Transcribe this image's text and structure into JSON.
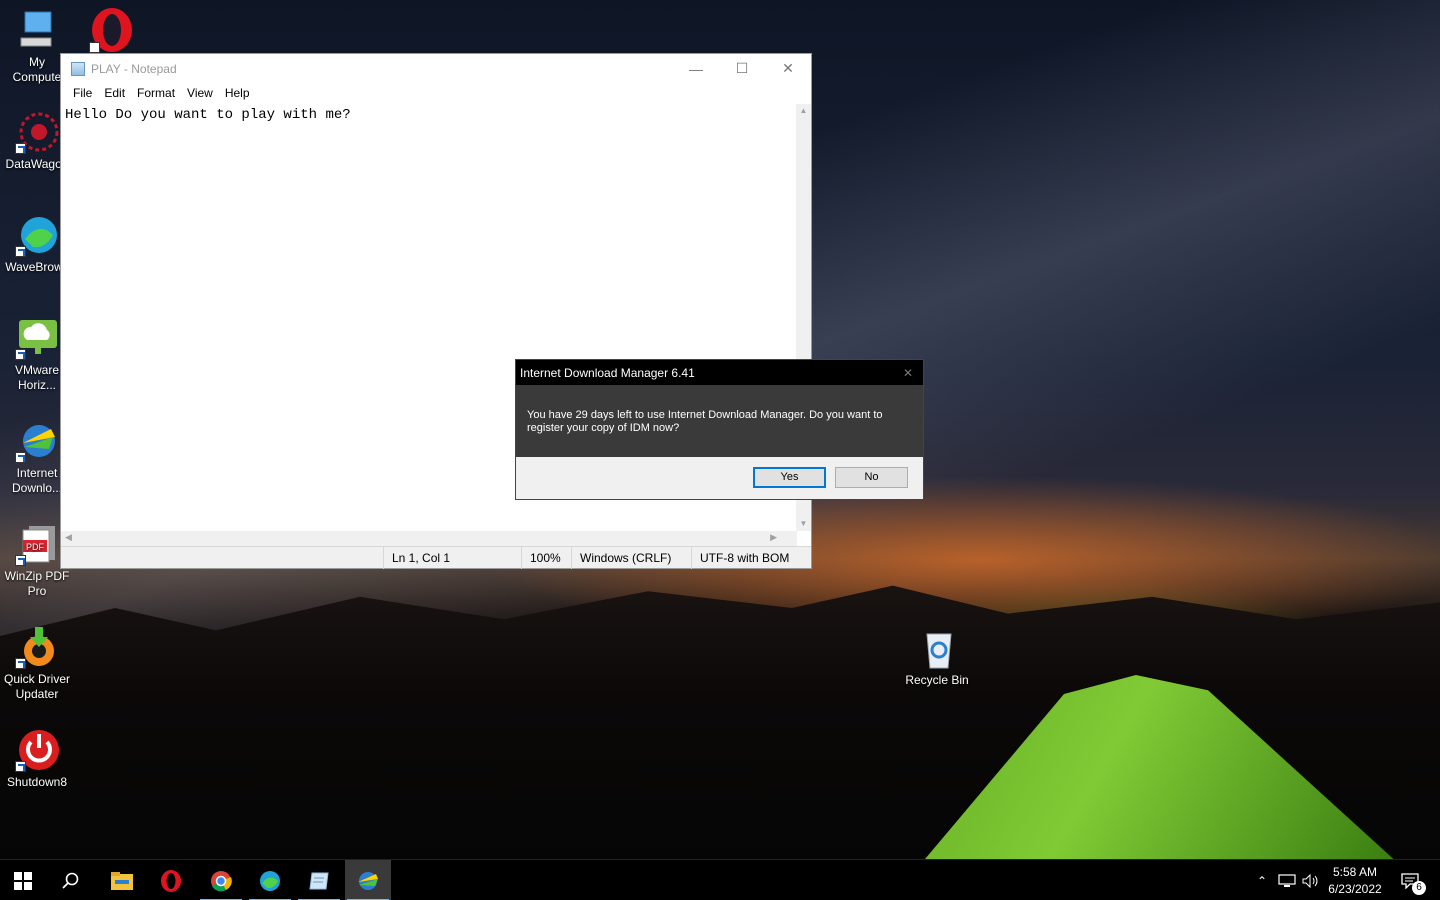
{
  "desktop": {
    "icons": [
      {
        "label": "My\nCompute",
        "icon": "computer-icon"
      },
      {
        "label": "DataWagon",
        "icon": "datawagon-icon"
      },
      {
        "label": "WaveBrows",
        "icon": "wavebrowser-icon"
      },
      {
        "label": "VMware\nHoriz...",
        "icon": "vmware-horizon-icon"
      },
      {
        "label": "Internet\nDownlo...",
        "icon": "idm-icon"
      },
      {
        "label": "WinZip PDF\nPro",
        "icon": "winzip-pdf-icon"
      },
      {
        "label": "Quick Driver\nUpdater",
        "icon": "quick-driver-updater-icon"
      },
      {
        "label": "Shutdown8",
        "icon": "shutdown-icon"
      },
      {
        "label": "Recycle Bin",
        "icon": "recycle-bin-icon"
      }
    ],
    "opera_icon": "opera-icon"
  },
  "notepad": {
    "title": "PLAY - Notepad",
    "menu": [
      "File",
      "Edit",
      "Format",
      "View",
      "Help"
    ],
    "content": "Hello Do you want to play with me?",
    "status": {
      "position": "Ln 1, Col 1",
      "zoom": "100%",
      "line_ending": "Windows (CRLF)",
      "encoding": "UTF-8 with BOM"
    }
  },
  "idm_dialog": {
    "title": "Internet Download Manager 6.41",
    "message": "You have 29 days left to use Internet Download Manager. Do you want to register your copy of IDM now?",
    "yes_label": "Yes",
    "no_label": "No"
  },
  "taskbar": {
    "apps": [
      "start-icon",
      "search-icon",
      "file-explorer-icon",
      "opera-icon",
      "chrome-icon",
      "wavebrowser-icon",
      "notepad-icon",
      "idm-icon"
    ],
    "time": "5:58 AM",
    "date": "6/23/2022",
    "notification_count": "6"
  },
  "colors": {
    "accent": "#0078d7",
    "tent_green": "#8ee03a",
    "opera_red": "#e0141e"
  }
}
